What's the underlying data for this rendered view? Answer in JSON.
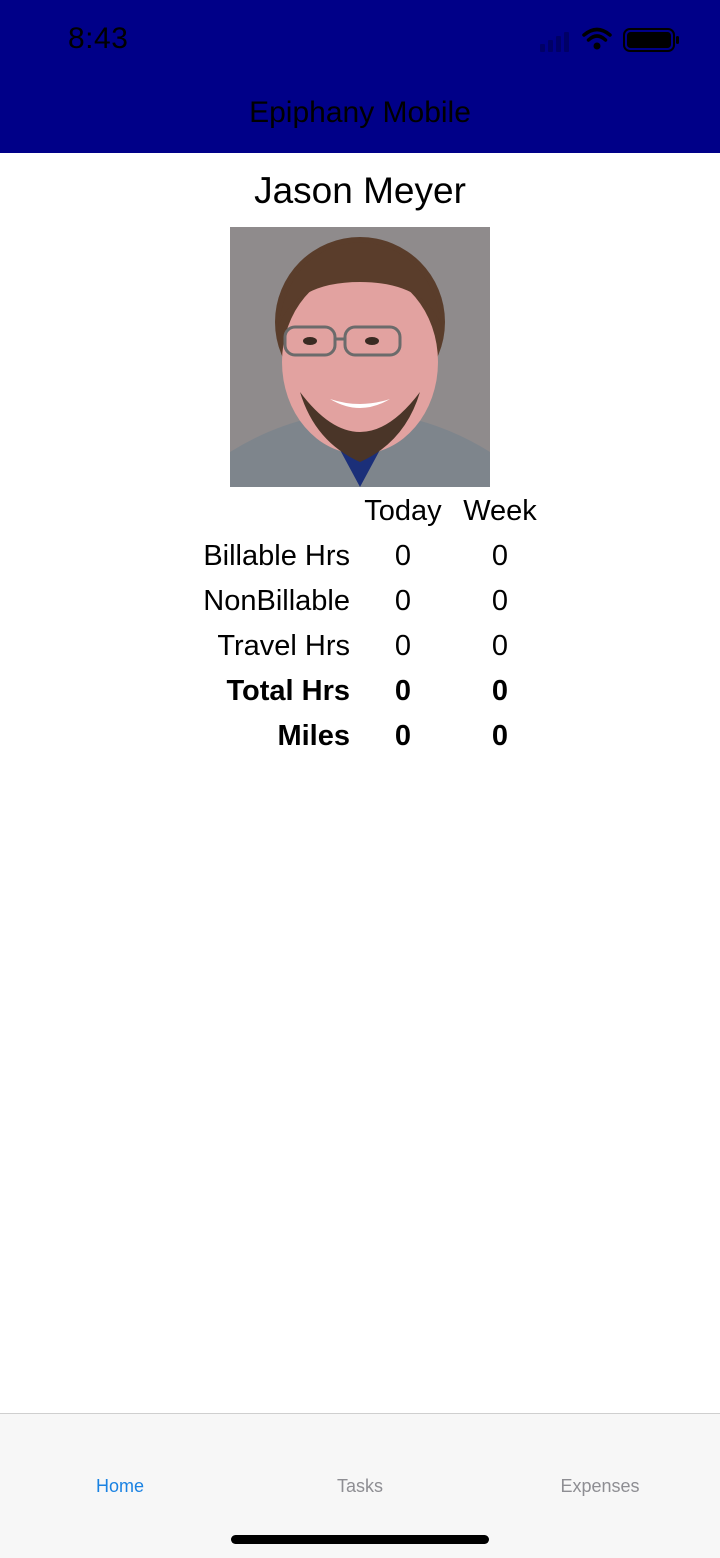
{
  "status_bar": {
    "time": "8:43",
    "icons": [
      "signal-icon",
      "wifi-icon",
      "battery-icon"
    ]
  },
  "header": {
    "title": "Epiphany Mobile",
    "background_color": "#000088"
  },
  "profile": {
    "name": "Jason Meyer",
    "photo": "user-photo"
  },
  "stats": {
    "columns": [
      "Today",
      "Week"
    ],
    "rows": [
      {
        "label": "Billable Hrs",
        "today": "0",
        "week": "0",
        "bold": false
      },
      {
        "label": "NonBillable",
        "today": "0",
        "week": "0",
        "bold": false
      },
      {
        "label": "Travel Hrs",
        "today": "0",
        "week": "0",
        "bold": false
      },
      {
        "label": "Total Hrs",
        "today": "0",
        "week": "0",
        "bold": true
      },
      {
        "label": "Miles",
        "today": "0",
        "week": "0",
        "bold": true
      }
    ]
  },
  "tabbar": {
    "tabs": [
      {
        "label": "Home",
        "active": true
      },
      {
        "label": "Tasks",
        "active": false
      },
      {
        "label": "Expenses",
        "active": false
      }
    ],
    "active_color": "#1a82e2",
    "inactive_color": "#8e8e93"
  }
}
